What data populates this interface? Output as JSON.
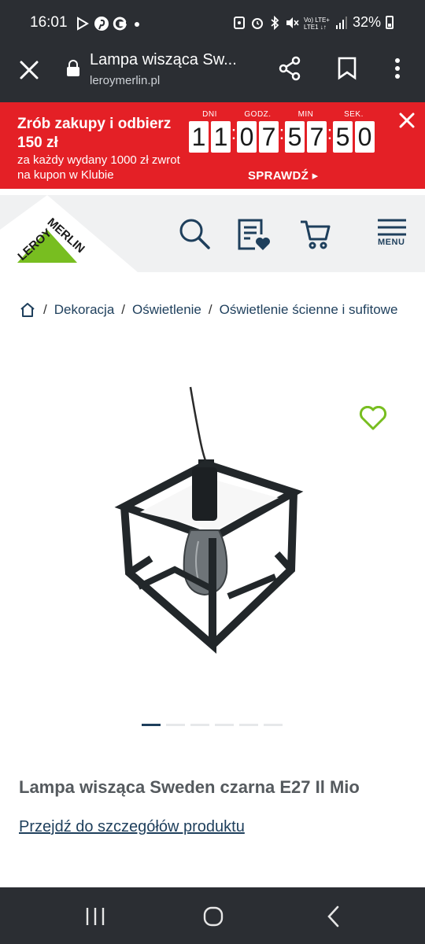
{
  "status_bar": {
    "time": "16:01",
    "battery": "32%",
    "icons": [
      "play-icon",
      "pinterest-icon",
      "google-icon",
      "dot-icon",
      "sync-icon",
      "alarm-icon",
      "bluetooth-icon",
      "mute-icon",
      "volte-icon",
      "signal-icon"
    ]
  },
  "browser": {
    "title": "Lampa wisząca Sw...",
    "url": "leroymerlin.pl"
  },
  "promo": {
    "headline": "Zrób zakupy i odbierz 150 zł",
    "subline": "za każdy wydany 1000 zł zwrot na kupon w Klubie",
    "cta": "SPRAWDŹ",
    "countdown": [
      {
        "label": "DNI",
        "digits": [
          "1",
          "1"
        ]
      },
      {
        "label": "GODZ.",
        "digits": [
          "0",
          "7"
        ]
      },
      {
        "label": "MIN",
        "digits": [
          "5",
          "7"
        ]
      },
      {
        "label": "SEK.",
        "digits": [
          "5",
          "0"
        ]
      }
    ]
  },
  "header": {
    "logo_top": "MERLIN",
    "logo_left": "LEROY",
    "menu_label": "MENU"
  },
  "breadcrumb": [
    "Dekoracja",
    "Oświetlenie",
    "Oświetlenie ścienne i sufitowe"
  ],
  "product": {
    "title": "Lampa wisząca Sweden czarna E27 Il Mio",
    "details_link": "Przejdź do szczegółów produktu",
    "gallery_count": 6,
    "gallery_active_index": 0
  },
  "colors": {
    "brand_green": "#78be20",
    "promo_red": "#e42026",
    "navy": "#1e3f5c",
    "bar_dark": "#2b2e33"
  }
}
